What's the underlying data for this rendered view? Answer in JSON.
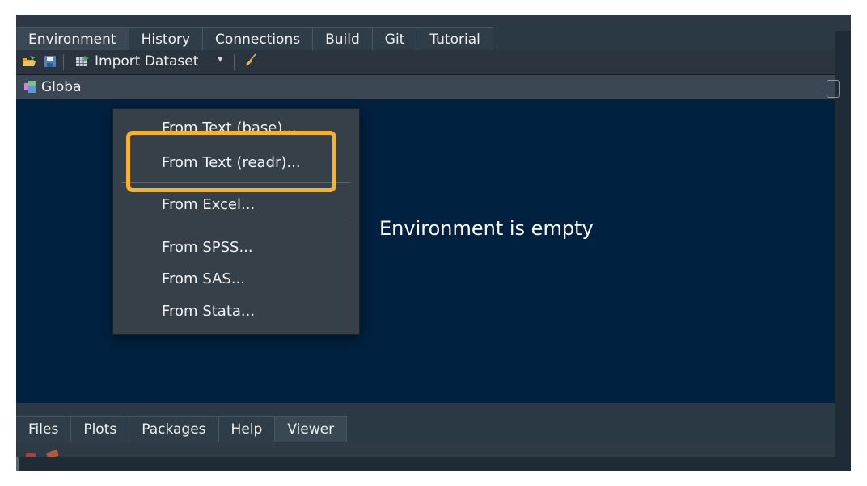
{
  "tabs": [
    "Environment",
    "History",
    "Connections",
    "Build",
    "Git",
    "Tutorial"
  ],
  "toolbar": {
    "import_label": "Import Dataset",
    "dropdown_arrow": "▾",
    "icons": [
      "open-folder-icon",
      "save-icon",
      "import-dataset-icon",
      "broom-icon"
    ]
  },
  "env": {
    "global_label": "Globa",
    "empty_message": "Environment is empty"
  },
  "import_menu": {
    "items": [
      "From Text (base)...",
      "From Text (readr)...",
      "From Excel...",
      "From SPSS...",
      "From SAS...",
      "From Stata..."
    ],
    "highlighted": "From Text (readr)...",
    "highlight_color": "#f6b22c"
  },
  "lower_tabs": [
    "Files",
    "Plots",
    "Packages",
    "Help",
    "Viewer"
  ],
  "colors": {
    "env_pane_bg": "#002140",
    "panel_bg": "#2b3944",
    "menu_bg": "#364049"
  }
}
